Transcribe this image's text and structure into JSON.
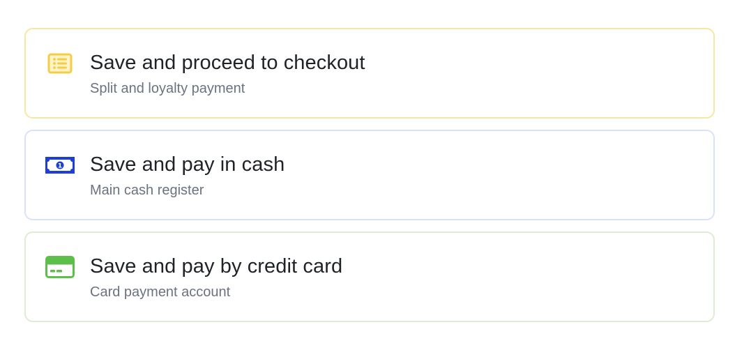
{
  "options": [
    {
      "title": "Save and proceed to checkout",
      "subtitle": "Split and loyalty payment",
      "icon": "list-icon",
      "color": "#f4cd45"
    },
    {
      "title": "Save and pay in cash",
      "subtitle": "Main cash register",
      "icon": "cash-icon",
      "color": "#1d3fd6"
    },
    {
      "title": "Save and pay by credit card",
      "subtitle": "Card payment account",
      "icon": "credit-card-icon",
      "color": "#5bbf4a"
    }
  ],
  "icon_glyphs": {
    "cash_denomination": "1"
  }
}
